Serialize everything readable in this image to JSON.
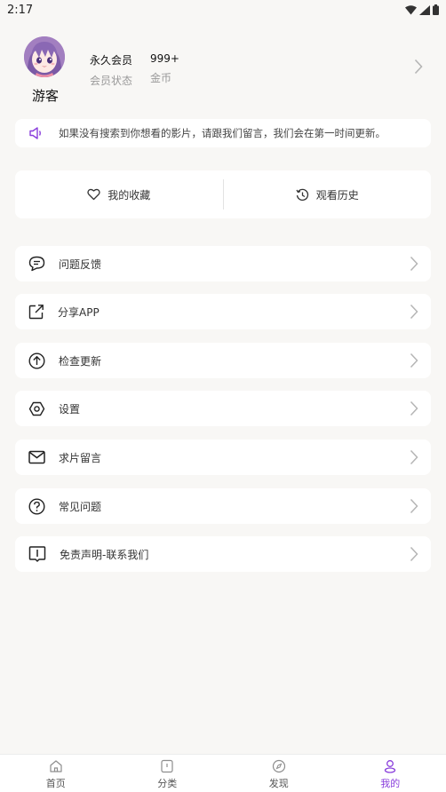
{
  "status_bar": {
    "time": "2:17"
  },
  "profile": {
    "name": "游客",
    "stats": [
      {
        "value": "永久会员",
        "label": "会员状态"
      },
      {
        "value": "999+",
        "label": "金币"
      }
    ]
  },
  "notice": {
    "text": "如果没有搜索到你想看的影片，请跟我们留言，我们会在第一时间更新。"
  },
  "quick_actions": [
    {
      "label": "我的收藏",
      "icon": "heart-icon"
    },
    {
      "label": "观看历史",
      "icon": "history-icon"
    }
  ],
  "menu": [
    {
      "label": "问题反馈",
      "icon": "feedback-icon"
    },
    {
      "label": "分享APP",
      "icon": "share-icon"
    },
    {
      "label": "检查更新",
      "icon": "update-icon"
    },
    {
      "label": "设置",
      "icon": "settings-icon"
    },
    {
      "label": "求片留言",
      "icon": "mail-icon"
    },
    {
      "label": "常见问题",
      "icon": "help-icon"
    },
    {
      "label": "免责声明-联系我们",
      "icon": "book-icon"
    }
  ],
  "tabs": [
    {
      "label": "首页",
      "icon": "home-icon"
    },
    {
      "label": "分类",
      "icon": "category-icon"
    },
    {
      "label": "发现",
      "icon": "discover-icon"
    },
    {
      "label": "我的",
      "icon": "user-icon",
      "active": true
    }
  ],
  "colors": {
    "accent": "#8a3fdc",
    "background": "#f8f7f5",
    "card": "#ffffff"
  }
}
